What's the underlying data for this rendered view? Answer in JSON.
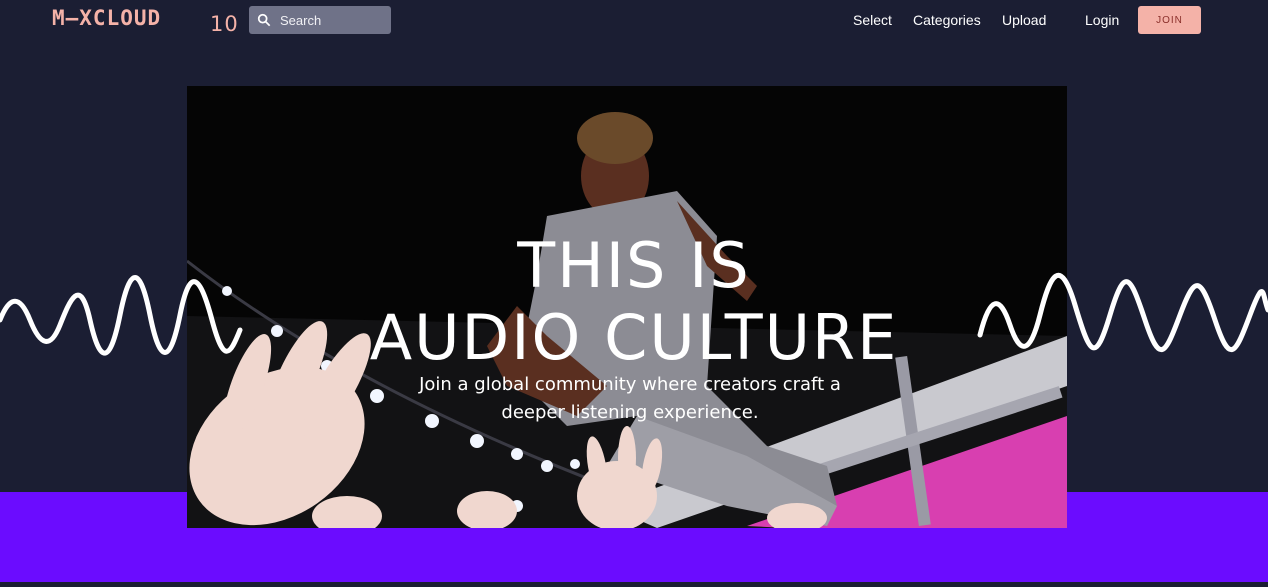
{
  "header": {
    "logo_text": "M—XCLOUD",
    "logo_suffix": "10",
    "search_placeholder": "Search",
    "nav": [
      "Select",
      "Categories",
      "Upload",
      "Login"
    ],
    "join_label": "JOIN"
  },
  "hero": {
    "headline_line1": "THIS IS",
    "headline_line2": "AUDIO CULTURE",
    "subtitle_line1": "Join a global community where creators craft a",
    "subtitle_line2": "deeper listening experience."
  },
  "colors": {
    "background": "#1b1e33",
    "accent": "#f4b2a8",
    "purple_band": "#6b0cff",
    "search_bg": "#6f7288"
  }
}
